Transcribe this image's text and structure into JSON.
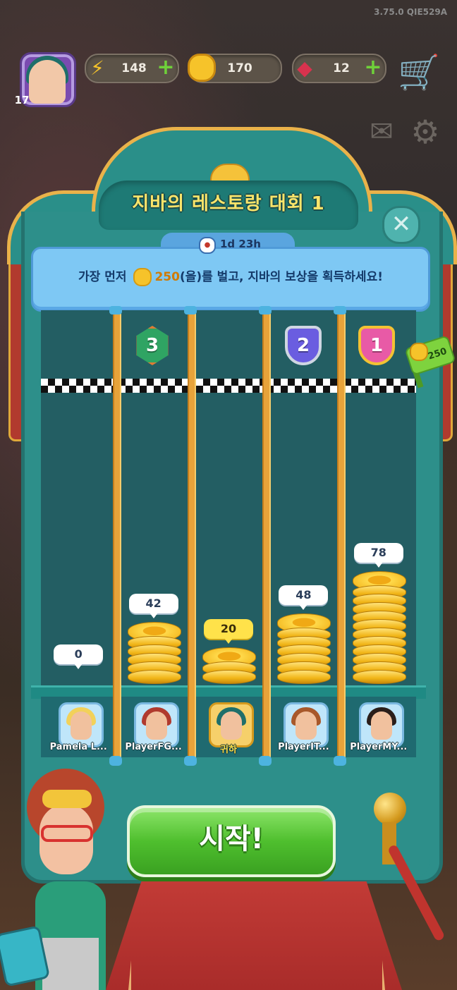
{
  "version": "3.75.0 QIE529A",
  "hud": {
    "level": "17",
    "energy": "148",
    "coins": "170",
    "gems": "12"
  },
  "event": {
    "title": "지바의 레스토랑 대회 1",
    "timer": "1d 23h",
    "banner_prefix": "가장 먼저",
    "banner_amount": "250",
    "banner_suffix": "(을)를 벌고, 지바의 보상을 획득하세요!",
    "prize_amount": "250"
  },
  "ranks": [
    "3",
    "2",
    "1"
  ],
  "lanes": [
    {
      "name": "Pamela L...",
      "score": "0",
      "coins": 0,
      "hair": "#f2d15a",
      "me": false
    },
    {
      "name": "PlayerFG...",
      "score": "42",
      "coins": 42,
      "hair": "#b03a2e",
      "me": false
    },
    {
      "name": "귀하",
      "score": "20",
      "coins": 20,
      "hair": "#1f6f6a",
      "me": true
    },
    {
      "name": "PlayerIT...",
      "score": "48",
      "coins": 48,
      "hair": "#a8582a",
      "me": false
    },
    {
      "name": "PlayerMY...",
      "score": "78",
      "coins": 78,
      "hair": "#2a1e1a",
      "me": false
    }
  ],
  "start_label": "시작!",
  "colors": {
    "board": "#2d8f8a",
    "gold_trim": "#e9b24a",
    "start_green": "#4fbf2e",
    "banner_blue": "#7ec8f4"
  },
  "icons": {
    "energy": "lightning-icon",
    "coin": "coin-icon",
    "gem": "gem-icon",
    "cart": "cart-icon",
    "mail": "mail-icon",
    "settings": "gear-icon",
    "close": "close-icon",
    "timer": "clock-icon"
  }
}
